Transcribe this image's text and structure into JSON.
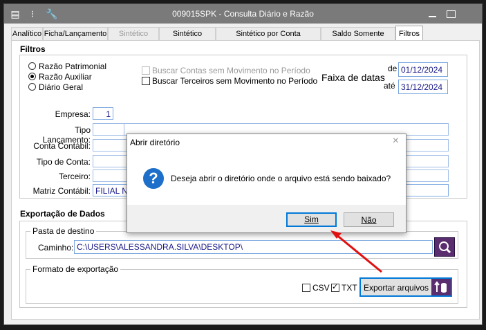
{
  "window": {
    "title": "009015SPK - Consulta Diário e Razão"
  },
  "tabs": [
    {
      "label": "Analítico",
      "state": "normal"
    },
    {
      "label": "Ficha/Lançamento",
      "state": "normal"
    },
    {
      "label": "Sintético Conta",
      "state": "disabled"
    },
    {
      "label": "Sintético Terceiro",
      "state": "normal"
    },
    {
      "label": "Sintético por Conta Contábil/Data",
      "state": "normal"
    },
    {
      "label": "Saldo Somente Terceiro",
      "state": "normal"
    },
    {
      "label": "Filtros",
      "state": "active"
    }
  ],
  "filtros": {
    "title": "Filtros",
    "radios": [
      {
        "label": "Razão Patrimonial",
        "selected": false
      },
      {
        "label": "Razão Auxiliar",
        "selected": true
      },
      {
        "label": "Diário Geral",
        "selected": false
      }
    ],
    "chk_contas": "Buscar Contas sem Movimento no Período",
    "chk_terceiros": "Buscar Terceiros sem Movimento no Período",
    "faixa_label": "Faixa de datas",
    "de_label": "de",
    "ate_label": "até",
    "de_value": "01/12/2024",
    "ate_value": "31/12/2024",
    "empresa_label": "Empresa:",
    "empresa_value": "1",
    "tipo_lanc_label": "Tipo Lançamento:",
    "conta_label": "Conta Contábil:",
    "tipo_conta_label": "Tipo de Conta:",
    "terceiro_label": "Terceiro:",
    "matriz_label": "Matriz Contábil:",
    "matriz_value": "FILIAL NFE"
  },
  "export": {
    "title": "Exportação de Dados",
    "pasta_title": "Pasta de destino",
    "caminho_label": "Caminho:",
    "caminho_value": "C:\\USERS\\ALESSANDRA.SILVA\\DESKTOP\\",
    "formato_title": "Formato de exportação",
    "csv_label": "CSV",
    "txt_label": "TXT",
    "button_label": "Exportar arquivos"
  },
  "dialog": {
    "title": "Abrir diretório",
    "message": "Deseja abrir o diretório onde o arquivo está sendo baixado?",
    "yes": "Sim",
    "no": "Não"
  },
  "colors": {
    "accent": "#0078d7",
    "arrow": "#e01010",
    "export_icon_bg": "#5a2d6e"
  }
}
